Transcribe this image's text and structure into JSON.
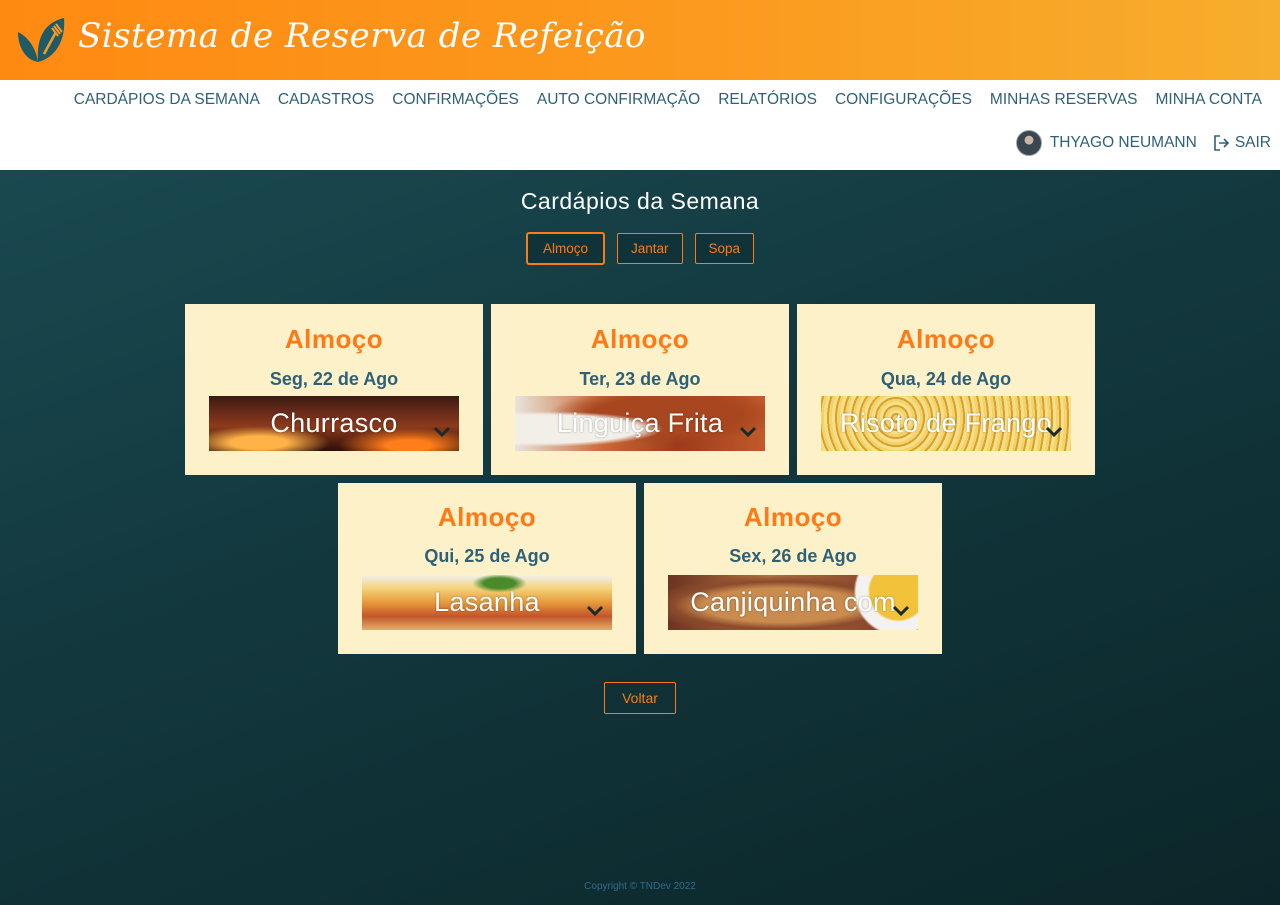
{
  "header": {
    "app_title": "Sistema de Reserva de Refeição",
    "logo_icon": "leaf-fork-logo",
    "brand_color": "#ff8a12"
  },
  "nav": {
    "items": [
      {
        "label": "CARDÁPIOS DA SEMANA"
      },
      {
        "label": "CADASTROS"
      },
      {
        "label": "CONFIRMAÇÕES"
      },
      {
        "label": "AUTO CONFIRMAÇÃO"
      },
      {
        "label": "RELATÓRIOS"
      },
      {
        "label": "CONFIGURAÇÕES"
      },
      {
        "label": "MINHAS RESERVAS"
      },
      {
        "label": "MINHA CONTA"
      }
    ],
    "user_name": "THYAGO NEUMANN",
    "logout_label": "SAIR"
  },
  "main": {
    "title": "Cardápios da Semana",
    "tabs": [
      {
        "label": "Almoço",
        "active": true
      },
      {
        "label": "Jantar",
        "active": false
      },
      {
        "label": "Sopa",
        "active": false
      }
    ],
    "cards": [
      {
        "meal": "Almoço",
        "date": "Seg, 22 de Ago",
        "dish": "Churrasco"
      },
      {
        "meal": "Almoço",
        "date": "Ter, 23 de Ago",
        "dish": "Linguiça Frita"
      },
      {
        "meal": "Almoço",
        "date": "Qua, 24 de Ago",
        "dish": "Risoto de Frango"
      },
      {
        "meal": "Almoço",
        "date": "Qui, 25 de Ago",
        "dish": "Lasanha"
      },
      {
        "meal": "Almoço",
        "date": "Sex, 26 de Ago",
        "dish": "Canjiquinha com"
      }
    ],
    "back_label": "Voltar"
  },
  "footer": {
    "copyright": "Copyright © TNDev 2022"
  },
  "colors": {
    "accent": "#ff7a16",
    "nav_text": "#2e6178",
    "card_bg": "#fcf1c9",
    "page_bg": "#133a40"
  }
}
